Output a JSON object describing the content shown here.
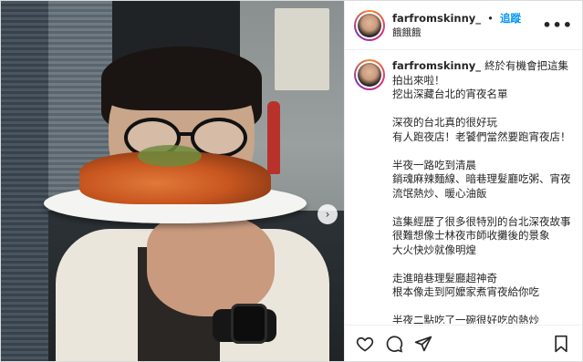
{
  "post": {
    "username": "farfromskinny_",
    "follow_label": "追蹤",
    "separator": "•",
    "location": "餓餓餓",
    "more_label": "•••",
    "next_label": "›"
  },
  "caption": {
    "username": "farfromskinny_",
    "paragraphs": [
      [
        "終於有機會把這集拍出來啦！",
        "挖出深藏台北的宵夜名單"
      ],
      [
        "深夜的台北真的很好玩",
        "有人跑夜店！老饕們當然要跑宵夜店！"
      ],
      [
        "半夜一路吃到清晨",
        "銷魂麻辣麵線、暗巷理髮廳吃粥、宵夜流氓熱炒、暖心油飯"
      ],
      [
        "這集經歷了很多很特別的台北深夜故事",
        "很難想像士林夜市師收攤後的景象",
        "大火快炒就像明煌"
      ],
      [
        "走進暗巷理髮廳超神奇",
        "根本像走到阿嬤家煮宵夜給你吃"
      ],
      [
        "半夜二點吃了一碗很好吃的熱炒"
      ]
    ]
  },
  "icons": {
    "like": "heart-icon",
    "comment": "comment-icon",
    "share": "share-icon",
    "save": "bookmark-icon",
    "next": "chevron-right-icon",
    "more": "more-icon"
  },
  "colors": {
    "link": "#0095f6",
    "text": "#262626",
    "border": "#dbdbdb"
  }
}
